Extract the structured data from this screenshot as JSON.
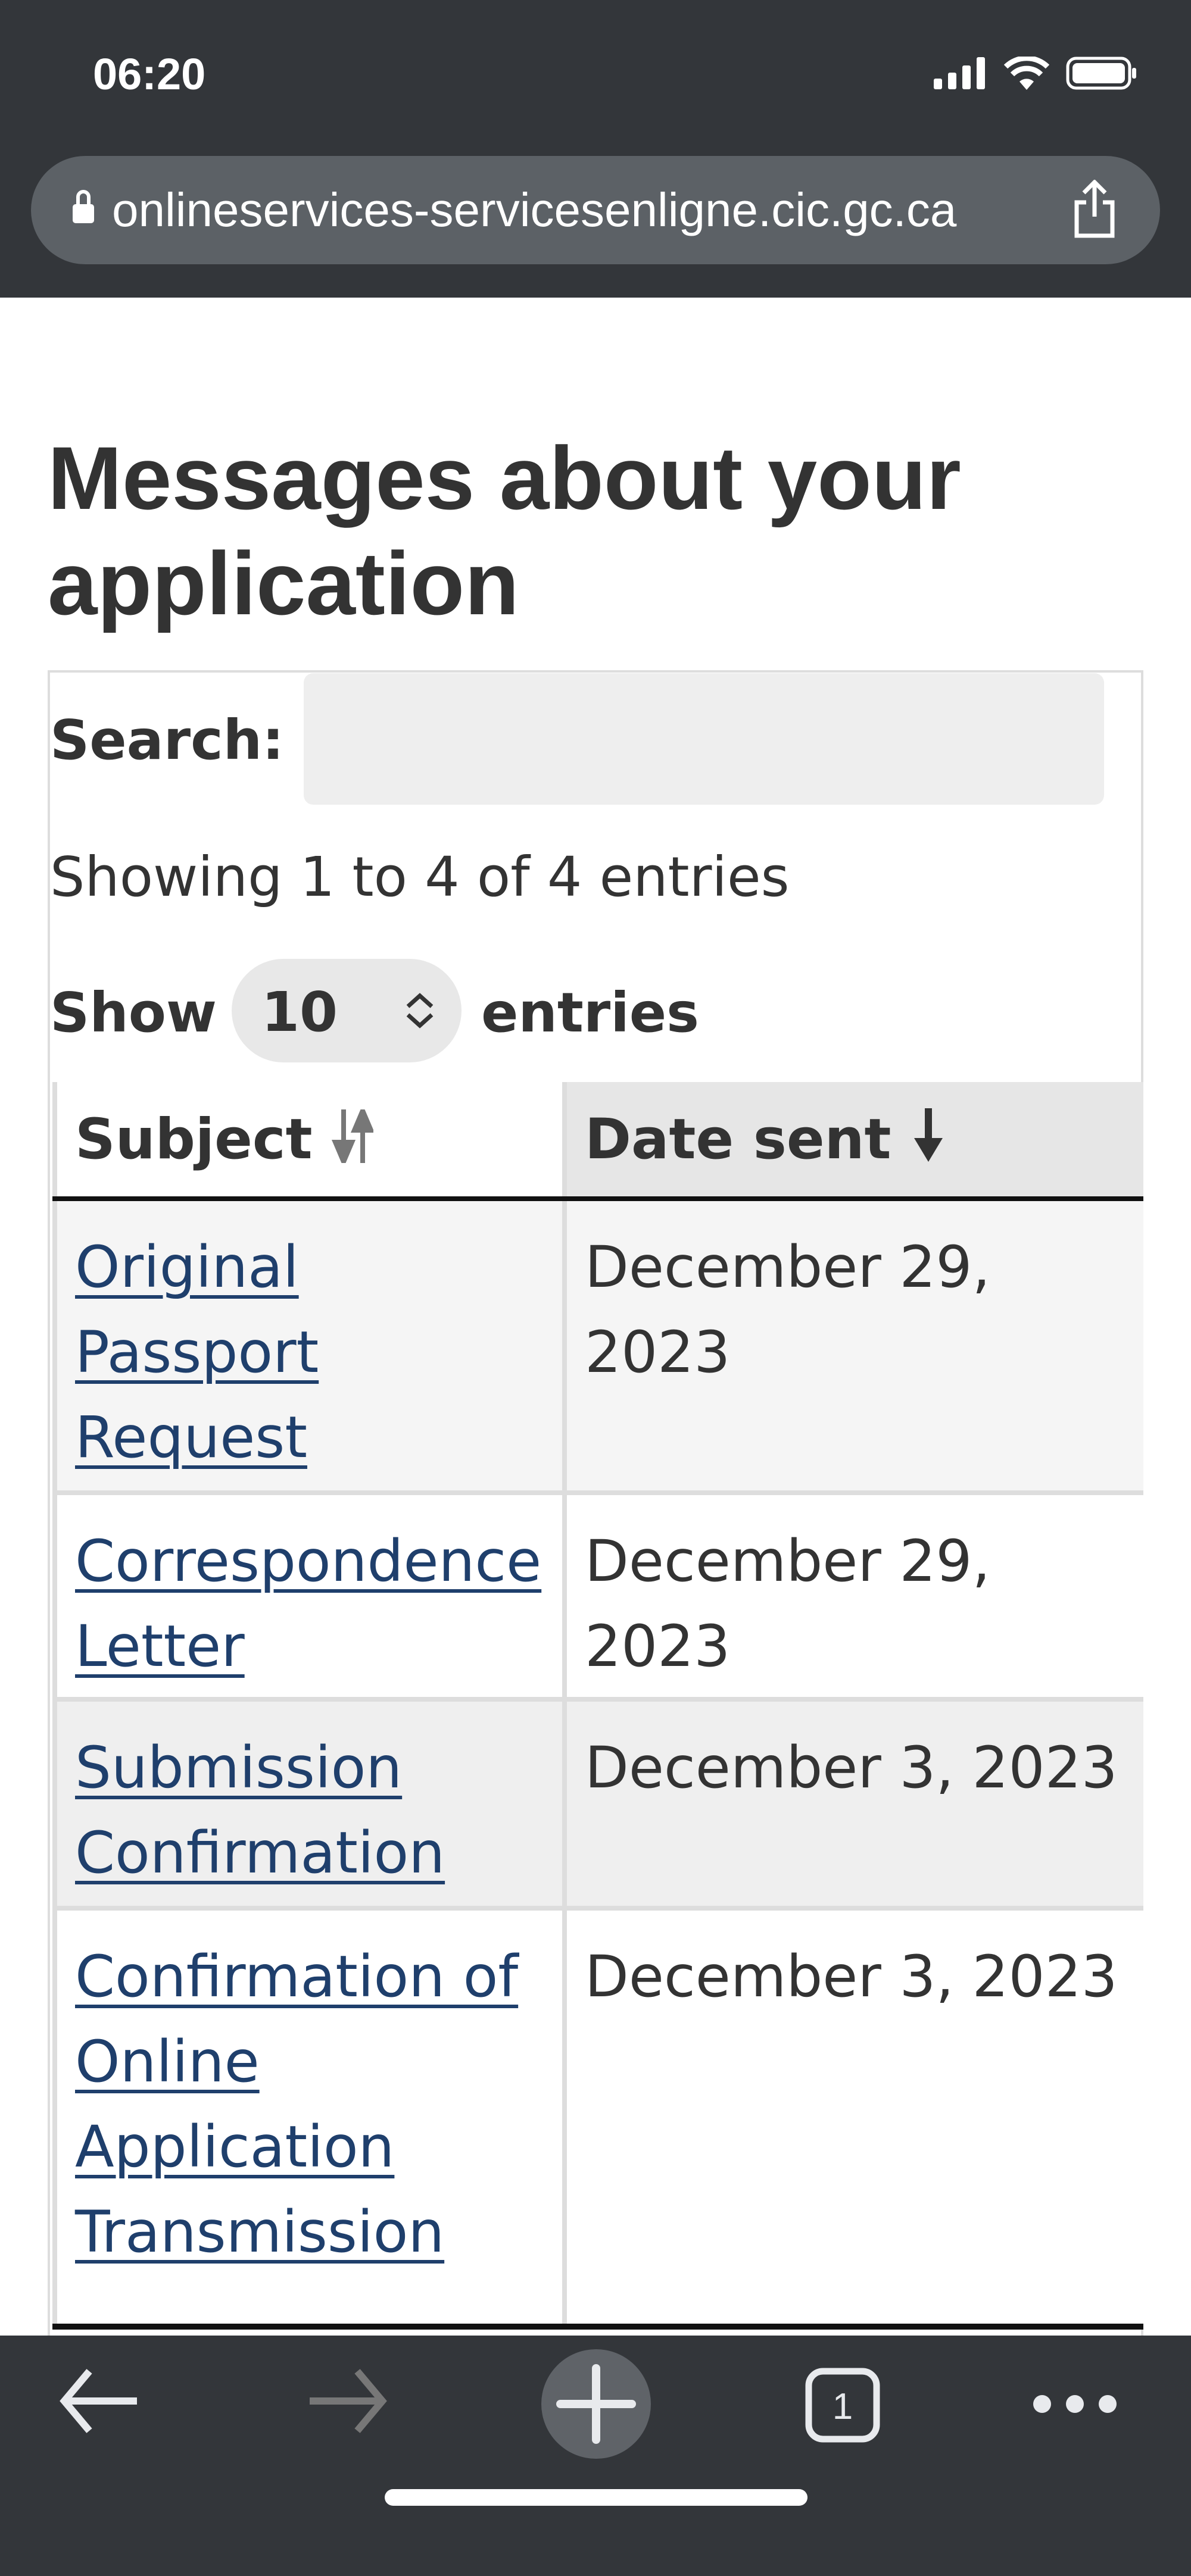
{
  "status_bar": {
    "time": "06:20",
    "icons": [
      "signal-icon",
      "wifi-icon",
      "battery-icon"
    ]
  },
  "browser": {
    "url": "onlineservices-servicesenligne.cic.gc.ca",
    "tab_count": "1"
  },
  "page": {
    "title": "Messages about your application"
  },
  "table_controls": {
    "search_label": "Search:",
    "search_value": "",
    "showing": "Showing 1 to 4 of 4 entries",
    "show_label": "Show",
    "page_size": "10",
    "entries_label": "entries"
  },
  "table": {
    "headers": [
      "Subject",
      "Date sent"
    ],
    "sort": {
      "column": "Date sent",
      "direction": "descending"
    },
    "rows": [
      {
        "subject": "Original Passport Request",
        "date": "December 29, 2023"
      },
      {
        "subject": "Correspondence Letter",
        "date": "December 29, 2023"
      },
      {
        "subject": "Submission Confirmation",
        "date": "December 3, 2023"
      },
      {
        "subject": "Confirmation of Online Application Transmission",
        "date": "December 3, 2023"
      }
    ]
  },
  "colors": {
    "link": "#1f3f6c",
    "chrome": "#33363a",
    "stripe": "#f5f5f5"
  }
}
